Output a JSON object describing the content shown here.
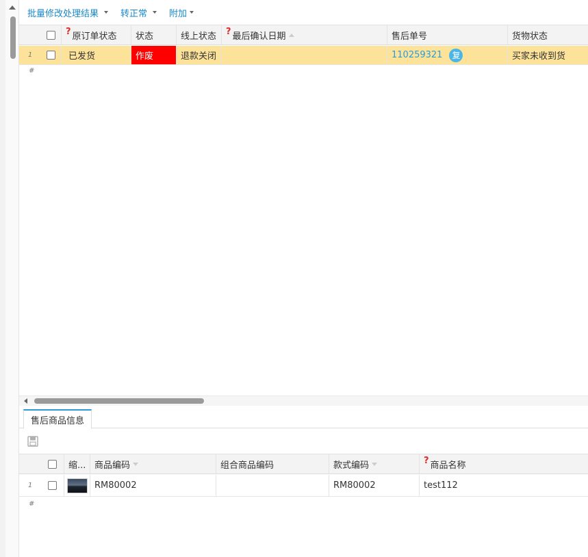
{
  "toolbar": {
    "batch_label": "批量修改处理结果",
    "normal_label": "转正常",
    "extra_label": "附加"
  },
  "top_grid": {
    "columns": {
      "orig_status": "原订单状态",
      "status": "状态",
      "online_status": "线上状态",
      "last_confirm": "最后确认日期",
      "aftersale_no": "售后单号",
      "goods_status": "货物状态"
    },
    "rows": [
      {
        "num": "1",
        "orig_status": "已发货",
        "status": "作废",
        "online_status": "退款关闭",
        "last_confirm": "",
        "aftersale_no": "110259321",
        "badge": "复",
        "goods_status": "买家未收到货"
      }
    ],
    "footer_marker": "#"
  },
  "tabs": {
    "active": "售后商品信息"
  },
  "bottom_grid": {
    "columns": {
      "thumb": "缩...",
      "sku": "商品编码",
      "combo_sku": "组合商品编码",
      "style_code": "款式编码",
      "name": "商品名称"
    },
    "rows": [
      {
        "num": "1",
        "sku": "RM80002",
        "combo_sku": "",
        "style_code": "RM80002",
        "name": "test112"
      }
    ],
    "footer_marker": "#"
  },
  "colors": {
    "accent": "#1a89c9",
    "row_highlight": "#fde39a",
    "void_status": "#ff0000"
  },
  "icons": [
    "caret-down-icon",
    "question-icon",
    "sort-icon",
    "save-icon",
    "image-thumbnail"
  ]
}
